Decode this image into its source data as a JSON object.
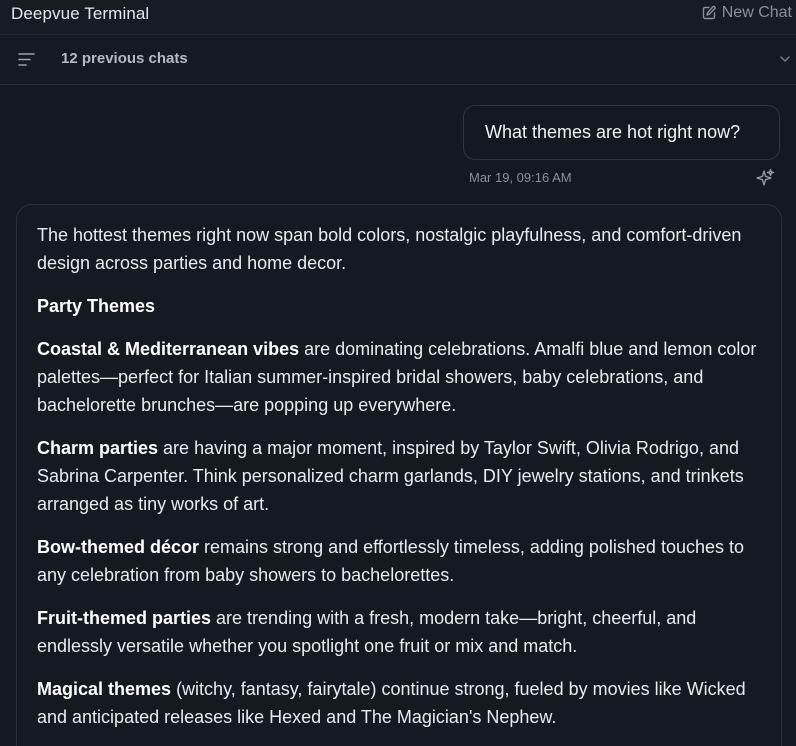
{
  "app": {
    "title": "Deepvue Terminal",
    "new_chat_label": "New Chat"
  },
  "chats_bar": {
    "label": "12 previous chats"
  },
  "user_message": {
    "text": "What themes are hot right now?",
    "timestamp": "Mar 19, 09:16 AM"
  },
  "answer": {
    "intro": "The hottest themes right now span bold colors, nostalgic playfulness, and comfort-driven design across parties and home decor.",
    "section_heading": "Party Themes",
    "items": [
      {
        "bold": "Coastal & Mediterranean vibes",
        "text": " are dominating celebrations. Amalfi blue and lemon color palettes—perfect for Italian summer-inspired bridal showers, baby celebrations, and bachelorette brunches—are popping up everywhere."
      },
      {
        "bold": "Charm parties",
        "text": " are having a major moment, inspired by Taylor Swift, Olivia Rodrigo, and Sabrina Carpenter. Think personalized charm garlands, DIY jewelry stations, and trinkets arranged as tiny works of art."
      },
      {
        "bold": "Bow-themed décor",
        "text": " remains strong and effortlessly timeless, adding polished touches to any celebration from baby showers to bachelorettes."
      },
      {
        "bold": "Fruit-themed parties",
        "text": " are trending with a fresh, modern take—bright, cheerful, and endlessly versatile whether you spotlight one fruit or mix and match."
      },
      {
        "bold": "Magical themes",
        "text": " (witchy, fantasy, fairytale) continue strong, fueled by movies like Wicked and anticipated releases like Hexed and The Magician's Nephew."
      }
    ]
  },
  "icons": {
    "new_chat": "edit-icon",
    "menu": "menu-lines-icon",
    "expand": "chevron-down-icon",
    "sparkle": "sparkle-icon"
  },
  "colors": {
    "background": "#141821",
    "text": "#e9ebef",
    "muted": "#8a909c",
    "border": "#2a303b"
  }
}
